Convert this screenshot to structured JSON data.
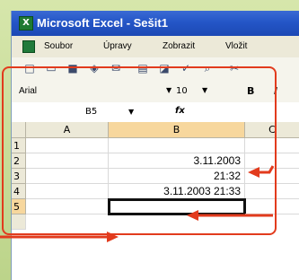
{
  "titlebar": {
    "title": "Microsoft Excel - Sešit1",
    "app_badge": "X"
  },
  "menu": {
    "items": [
      "Soubor",
      "Úpravy",
      "Zobrazit",
      "Vložit"
    ]
  },
  "formatting": {
    "font_name": "Arial",
    "font_size": "10",
    "bold_label": "B",
    "italic_label": "I"
  },
  "formula": {
    "name_box": "B5",
    "fx_label": "fx"
  },
  "grid": {
    "columns": [
      "A",
      "B",
      "C"
    ],
    "rows": [
      "1",
      "2",
      "3",
      "4",
      "5"
    ],
    "cells": {
      "B2": "3.11.2003",
      "B3": "21:32",
      "B4": "3.11.2003 21:33"
    },
    "selected_cell": "B5"
  },
  "colors": {
    "title_blue": "#2456c7",
    "highlight_red": "#e23b1d",
    "frame_green": "#c9dc9e",
    "toolbar": "#ece9d8"
  },
  "icons": [
    "new-icon",
    "open-icon",
    "save-icon",
    "print-icon",
    "preview-icon",
    "spellcheck-icon",
    "cut-icon"
  ]
}
